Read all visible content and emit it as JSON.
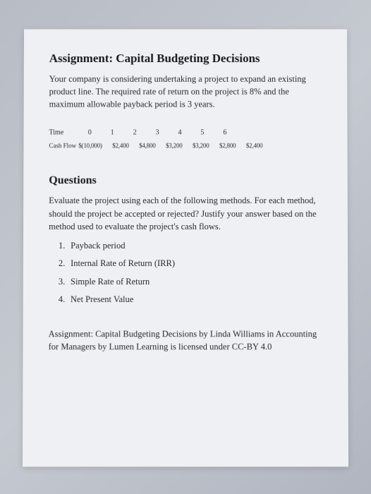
{
  "title": "Assignment: Capital Budgeting Decisions",
  "intro": "Your company is considering undertaking a project to expand an existing product line. The required rate of return on the project is 8% and the maximum allowable payback period is 3 years.",
  "table": {
    "time_label": "Time",
    "time_values": [
      "0",
      "1",
      "2",
      "3",
      "4",
      "5",
      "6"
    ],
    "cash_label": "Cash Flow",
    "cash_values": [
      "$(10,000)",
      "$2,400",
      "$4,800",
      "$3,200",
      "$3,200",
      "$2,800",
      "$2,400"
    ]
  },
  "questions_title": "Questions",
  "questions_intro": "Evaluate the project using each of the following methods. For each method, should the project be accepted or rejected? Justify your answer based on the method used to evaluate the project's cash flows.",
  "questions": [
    {
      "num": "1.",
      "text": "Payback period"
    },
    {
      "num": "2.",
      "text": "Internal Rate of Return (IRR)"
    },
    {
      "num": "3.",
      "text": "Simple Rate of Return"
    },
    {
      "num": "4.",
      "text": "Net Present Value"
    }
  ],
  "attribution": "Assignment: Capital Budgeting Decisions by Linda Williams in Accounting for Managers by Lumen Learning is licensed under CC-BY 4.0"
}
